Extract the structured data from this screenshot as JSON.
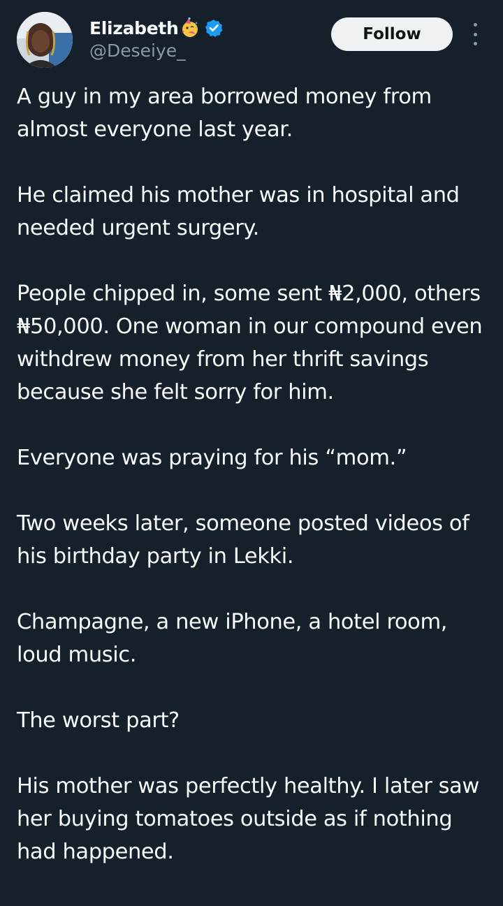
{
  "author": {
    "display_name": "Elizabeth",
    "handle": "@Deseiye_",
    "emoji": "partying-face-emoji",
    "verified": true,
    "verified_color": "#1d9bf0"
  },
  "actions": {
    "follow_label": "Follow",
    "more_icon": "more-vertical-icon"
  },
  "tweet": {
    "paragraphs": [
      "A guy in my area borrowed money from almost everyone last year.",
      "He claimed his mother was in hospital and needed urgent surgery.",
      "People chipped in, some sent ₦2,000, others ₦50,000. One woman in our compound even withdrew money from her thrift savings because she felt sorry for him.",
      "Everyone was praying for his “mom.”",
      "Two weeks later, someone posted videos of his birthday party in Lekki.",
      "Champagne, a new iPhone, a hotel room, loud music.",
      "The worst part?",
      "His mother was perfectly healthy. I later saw her buying tomatoes outside as if nothing had happened."
    ]
  },
  "colors": {
    "background": "#15202b",
    "text_primary": "#f7f9f9",
    "text_secondary": "#8b98a5",
    "button_bg": "#eff3f4"
  }
}
